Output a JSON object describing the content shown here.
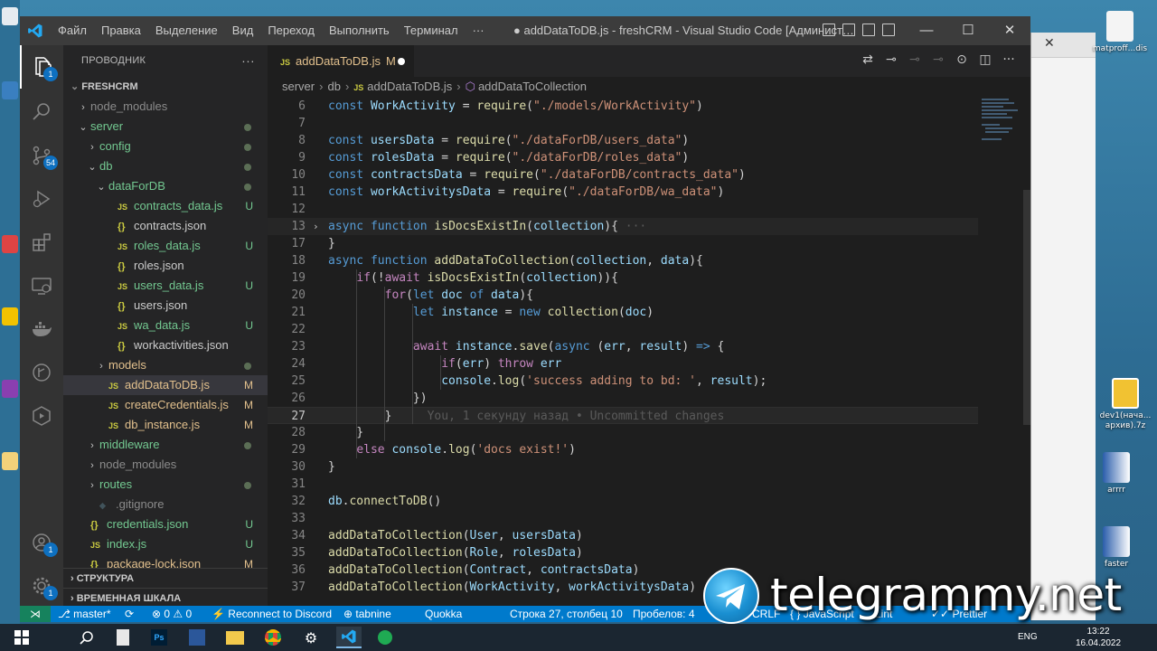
{
  "window": {
    "title": "● addDataToDB.js - freshCRM - Visual Studio Code [Админист…",
    "menu": [
      "Файл",
      "Правка",
      "Выделение",
      "Вид",
      "Переход",
      "Выполнить",
      "Терминал",
      "···"
    ]
  },
  "activity": {
    "explorer_badge": "1",
    "scm_badge": "54",
    "accounts_badge": "1",
    "settings_badge": "1"
  },
  "sidebar": {
    "header": "ПРОВОДНИК",
    "folder": "FRESHCRM",
    "tree": [
      {
        "label": "node_modules",
        "chev": "›",
        "indent": 0,
        "kind": "folder",
        "dim": true,
        "status": ""
      },
      {
        "label": "server",
        "chev": "⌄",
        "indent": 0,
        "kind": "folder",
        "color": "u",
        "status": "dot"
      },
      {
        "label": "config",
        "chev": "›",
        "indent": 1,
        "kind": "folder",
        "color": "u",
        "status": "dot"
      },
      {
        "label": "db",
        "chev": "⌄",
        "indent": 1,
        "kind": "folder",
        "color": "u",
        "status": "dot"
      },
      {
        "label": "dataForDB",
        "chev": "⌄",
        "indent": 2,
        "kind": "folder",
        "color": "u",
        "status": "dot"
      },
      {
        "label": "contracts_data.js",
        "indent": 3,
        "kind": "js",
        "color": "u",
        "status": "U"
      },
      {
        "label": "contracts.json",
        "indent": 3,
        "kind": "json",
        "status": ""
      },
      {
        "label": "roles_data.js",
        "indent": 3,
        "kind": "js",
        "color": "u",
        "status": "U"
      },
      {
        "label": "roles.json",
        "indent": 3,
        "kind": "json",
        "status": ""
      },
      {
        "label": "users_data.js",
        "indent": 3,
        "kind": "js",
        "color": "u",
        "status": "U"
      },
      {
        "label": "users.json",
        "indent": 3,
        "kind": "json",
        "status": ""
      },
      {
        "label": "wa_data.js",
        "indent": 3,
        "kind": "js",
        "color": "u",
        "status": "U"
      },
      {
        "label": "workactivities.json",
        "indent": 3,
        "kind": "json",
        "status": ""
      },
      {
        "label": "models",
        "chev": "›",
        "indent": 2,
        "kind": "folder",
        "color": "m",
        "status": "dot"
      },
      {
        "label": "addDataToDB.js",
        "indent": 2,
        "kind": "js",
        "color": "m",
        "status": "M",
        "selected": true
      },
      {
        "label": "createCredentials.js",
        "indent": 2,
        "kind": "js",
        "color": "m",
        "status": "M"
      },
      {
        "label": "db_instance.js",
        "indent": 2,
        "kind": "js",
        "color": "m",
        "status": "M"
      },
      {
        "label": "middleware",
        "chev": "›",
        "indent": 1,
        "kind": "folder",
        "color": "u",
        "status": "dot"
      },
      {
        "label": "node_modules",
        "chev": "›",
        "indent": 1,
        "kind": "folder",
        "dim": true,
        "status": ""
      },
      {
        "label": "routes",
        "chev": "›",
        "indent": 1,
        "kind": "folder",
        "color": "u",
        "status": "dot"
      },
      {
        "label": ".gitignore",
        "indent": 1,
        "kind": "git",
        "dim": true,
        "status": ""
      },
      {
        "label": "credentials.json",
        "indent": 0,
        "kind": "json",
        "color": "u",
        "status": "U"
      },
      {
        "label": "index.js",
        "indent": 0,
        "kind": "js",
        "color": "u",
        "status": "U"
      },
      {
        "label": "package-lock.json",
        "indent": 0,
        "kind": "json",
        "color": "m",
        "status": "M"
      }
    ],
    "outline": "СТРУКТУРА",
    "timeline": "ВРЕМЕННАЯ ШКАЛА"
  },
  "editor": {
    "tab": {
      "label": "addDataToDB.js",
      "status": "M"
    },
    "breadcrumb": [
      "server",
      "db",
      "addDataToDB.js",
      "addDataToCollection"
    ],
    "lines": [
      {
        "n": "6",
        "t": [
          [
            "k",
            "const "
          ],
          [
            "v",
            "WorkActivity"
          ],
          [
            "p",
            " = "
          ],
          [
            "f",
            "require"
          ],
          [
            "p",
            "("
          ],
          [
            "s",
            "\"./models/WorkActivity\""
          ],
          [
            "p",
            ")"
          ]
        ]
      },
      {
        "n": "7",
        "t": []
      },
      {
        "n": "8",
        "t": [
          [
            "k",
            "const "
          ],
          [
            "v",
            "usersData"
          ],
          [
            "p",
            " = "
          ],
          [
            "f",
            "require"
          ],
          [
            "p",
            "("
          ],
          [
            "s",
            "\"./dataForDB/users_data\""
          ],
          [
            "p",
            ")"
          ]
        ]
      },
      {
        "n": "9",
        "t": [
          [
            "k",
            "const "
          ],
          [
            "v",
            "rolesData"
          ],
          [
            "p",
            " = "
          ],
          [
            "f",
            "require"
          ],
          [
            "p",
            "("
          ],
          [
            "s",
            "\"./dataForDB/roles_data\""
          ],
          [
            "p",
            ")"
          ]
        ]
      },
      {
        "n": "10",
        "t": [
          [
            "k",
            "const "
          ],
          [
            "v",
            "contractsData"
          ],
          [
            "p",
            " = "
          ],
          [
            "f",
            "require"
          ],
          [
            "p",
            "("
          ],
          [
            "s",
            "\"./dataForDB/contracts_data\""
          ],
          [
            "p",
            ")"
          ]
        ]
      },
      {
        "n": "11",
        "t": [
          [
            "k",
            "const "
          ],
          [
            "v",
            "workActivitysData"
          ],
          [
            "p",
            " = "
          ],
          [
            "f",
            "require"
          ],
          [
            "p",
            "("
          ],
          [
            "s",
            "\"./dataForDB/wa_data\""
          ],
          [
            "p",
            ")"
          ]
        ]
      },
      {
        "n": "12",
        "t": []
      },
      {
        "n": "13",
        "fold": "›",
        "highlight": true,
        "t": [
          [
            "k",
            "async "
          ],
          [
            "k",
            "function "
          ],
          [
            "f",
            "isDocsExistIn"
          ],
          [
            "p",
            "("
          ],
          [
            "v",
            "collection"
          ],
          [
            "p",
            "){"
          ],
          [
            "g",
            " ···"
          ]
        ]
      },
      {
        "n": "17",
        "t": [
          [
            "p",
            "}"
          ]
        ]
      },
      {
        "n": "18",
        "t": [
          [
            "k",
            "async "
          ],
          [
            "k",
            "function "
          ],
          [
            "f",
            "addDataToCollection"
          ],
          [
            "p",
            "("
          ],
          [
            "v",
            "collection"
          ],
          [
            "p",
            ", "
          ],
          [
            "v",
            "data"
          ],
          [
            "p",
            "){"
          ]
        ]
      },
      {
        "n": "19",
        "t": [
          [
            "p",
            "    "
          ],
          [
            "cf",
            "if"
          ],
          [
            "p",
            "(!"
          ],
          [
            "cf",
            "await "
          ],
          [
            "f",
            "isDocsExistIn"
          ],
          [
            "p",
            "("
          ],
          [
            "v",
            "collection"
          ],
          [
            "p",
            ")){"
          ]
        ]
      },
      {
        "n": "20",
        "t": [
          [
            "p",
            "        "
          ],
          [
            "cf",
            "for"
          ],
          [
            "p",
            "("
          ],
          [
            "k",
            "let "
          ],
          [
            "v",
            "doc "
          ],
          [
            "k",
            "of "
          ],
          [
            "v",
            "data"
          ],
          [
            "p",
            "){"
          ]
        ]
      },
      {
        "n": "21",
        "t": [
          [
            "p",
            "            "
          ],
          [
            "k",
            "let "
          ],
          [
            "v",
            "instance"
          ],
          [
            "p",
            " = "
          ],
          [
            "k",
            "new "
          ],
          [
            "f",
            "collection"
          ],
          [
            "p",
            "("
          ],
          [
            "v",
            "doc"
          ],
          [
            "p",
            ")"
          ]
        ]
      },
      {
        "n": "22",
        "t": []
      },
      {
        "n": "23",
        "t": [
          [
            "p",
            "            "
          ],
          [
            "cf",
            "await "
          ],
          [
            "v",
            "instance"
          ],
          [
            "p",
            "."
          ],
          [
            "f",
            "save"
          ],
          [
            "p",
            "("
          ],
          [
            "k",
            "async "
          ],
          [
            "p",
            "("
          ],
          [
            "v",
            "err"
          ],
          [
            "p",
            ", "
          ],
          [
            "v",
            "result"
          ],
          [
            "p",
            ") "
          ],
          [
            "k",
            "=>"
          ],
          [
            "p",
            " {"
          ]
        ]
      },
      {
        "n": "24",
        "t": [
          [
            "p",
            "                "
          ],
          [
            "cf",
            "if"
          ],
          [
            "p",
            "("
          ],
          [
            "v",
            "err"
          ],
          [
            "p",
            ") "
          ],
          [
            "cf",
            "throw "
          ],
          [
            "v",
            "err"
          ]
        ]
      },
      {
        "n": "25",
        "t": [
          [
            "p",
            "                "
          ],
          [
            "v",
            "console"
          ],
          [
            "p",
            "."
          ],
          [
            "f",
            "log"
          ],
          [
            "p",
            "("
          ],
          [
            "s",
            "'success adding to bd: '"
          ],
          [
            "p",
            ", "
          ],
          [
            "v",
            "result"
          ],
          [
            "p",
            ");"
          ]
        ]
      },
      {
        "n": "26",
        "t": [
          [
            "p",
            "            })"
          ]
        ]
      },
      {
        "n": "27",
        "current": true,
        "t": [
          [
            "p",
            "        }"
          ],
          [
            "g",
            "     You, 1 секунду назад • Uncommitted changes"
          ]
        ]
      },
      {
        "n": "28",
        "t": [
          [
            "p",
            "    }"
          ]
        ]
      },
      {
        "n": "29",
        "t": [
          [
            "p",
            "    "
          ],
          [
            "cf",
            "else "
          ],
          [
            "v",
            "console"
          ],
          [
            "p",
            "."
          ],
          [
            "f",
            "log"
          ],
          [
            "p",
            "("
          ],
          [
            "s",
            "'docs exist!'"
          ],
          [
            "p",
            ")"
          ]
        ]
      },
      {
        "n": "30",
        "t": [
          [
            "p",
            "}"
          ]
        ]
      },
      {
        "n": "31",
        "t": []
      },
      {
        "n": "32",
        "t": [
          [
            "v",
            "db"
          ],
          [
            "p",
            "."
          ],
          [
            "f",
            "connectToDB"
          ],
          [
            "p",
            "()"
          ]
        ]
      },
      {
        "n": "33",
        "t": []
      },
      {
        "n": "34",
        "t": [
          [
            "f",
            "addDataToCollection"
          ],
          [
            "p",
            "("
          ],
          [
            "v",
            "User"
          ],
          [
            "p",
            ", "
          ],
          [
            "v",
            "usersData"
          ],
          [
            "p",
            ")"
          ]
        ]
      },
      {
        "n": "35",
        "t": [
          [
            "f",
            "addDataToCollection"
          ],
          [
            "p",
            "("
          ],
          [
            "v",
            "Role"
          ],
          [
            "p",
            ", "
          ],
          [
            "v",
            "rolesData"
          ],
          [
            "p",
            ")"
          ]
        ]
      },
      {
        "n": "36",
        "t": [
          [
            "f",
            "addDataToCollection"
          ],
          [
            "p",
            "("
          ],
          [
            "v",
            "Contract"
          ],
          [
            "p",
            ", "
          ],
          [
            "v",
            "contractsData"
          ],
          [
            "p",
            ")"
          ]
        ]
      },
      {
        "n": "37",
        "t": [
          [
            "f",
            "addDataToCollection"
          ],
          [
            "p",
            "("
          ],
          [
            "v",
            "WorkActivity"
          ],
          [
            "p",
            ", "
          ],
          [
            "v",
            "workActivitysData"
          ],
          [
            "p",
            ")"
          ]
        ]
      }
    ]
  },
  "status": {
    "branch": "master*",
    "errors": "0",
    "warnings": "0",
    "discord": "Reconnect to Discord",
    "tabnine": "tabnine",
    "quokka": "Quokka",
    "position": "Строка 27, столбец 10",
    "spaces": "Пробелов: 4",
    "eol": "CRLF",
    "language": "JavaScript",
    "lint": "Lint",
    "prettier": "Prettier"
  },
  "desktop": {
    "icons": [
      {
        "label": "dev1(начальные архивы).7z",
        "short": "dev1(нача... архив).7z"
      },
      {
        "label": "arrrr",
        "short": "arrrr"
      },
      {
        "label": "faster",
        "short": "faster"
      },
      {
        "label": "matproff",
        "short": "matproff...dis"
      }
    ]
  },
  "taskbar": {
    "lang": "ENG",
    "time": "13:22",
    "date": "16.04.2022"
  },
  "watermark": {
    "text": "telegrammy.net"
  },
  "colors": {
    "statusbar": "#007acc",
    "activitybar": "#333333",
    "editor_bg": "#1e1e1e",
    "sidebar_bg": "#252526"
  }
}
